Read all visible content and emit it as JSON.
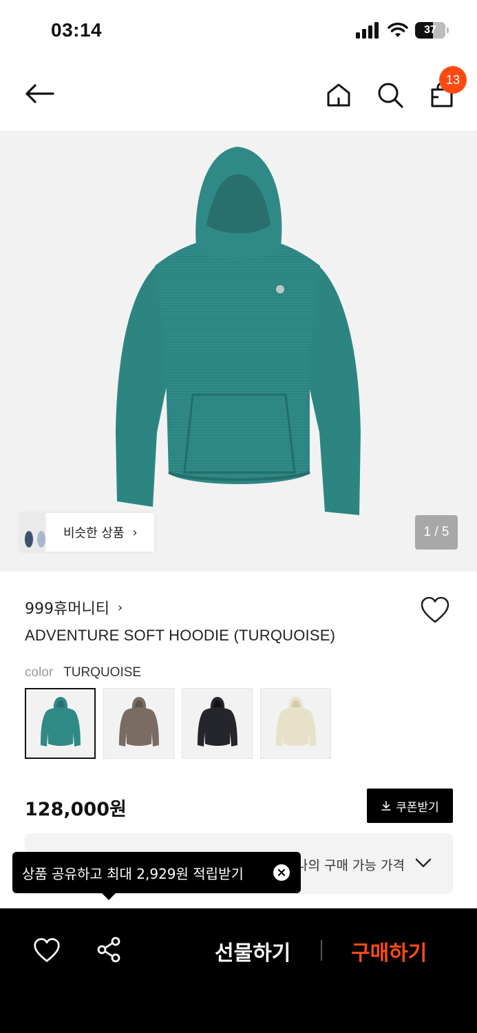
{
  "status_bar": {
    "time": "03:14",
    "battery": "37"
  },
  "header": {
    "cart_count": "13"
  },
  "gallery": {
    "similar_label": "비슷한 상품",
    "page_indicator": "1 / 5"
  },
  "product": {
    "brand": "999휴머니티",
    "title": "ADVENTURE SOFT HOODIE (TURQUOISE)",
    "color_label": "color",
    "color_value": "TURQUOISE",
    "swatches": [
      "turquoise",
      "brown",
      "black",
      "cream"
    ],
    "price": "128,000원",
    "coupon_label": "쿠폰받기",
    "price_box_text": "나의 구매 가능 가격"
  },
  "tooltip": {
    "text": "상품 공유하고 최대 2,929원 적립받기"
  },
  "bottom_bar": {
    "gift_label": "선물하기",
    "buy_label": "구매하기"
  },
  "colors": {
    "accent": "#ff4b12",
    "turquoise": "#2f8a87",
    "brown": "#7a6b63",
    "black": "#24262b",
    "cream": "#e6e1c8"
  }
}
